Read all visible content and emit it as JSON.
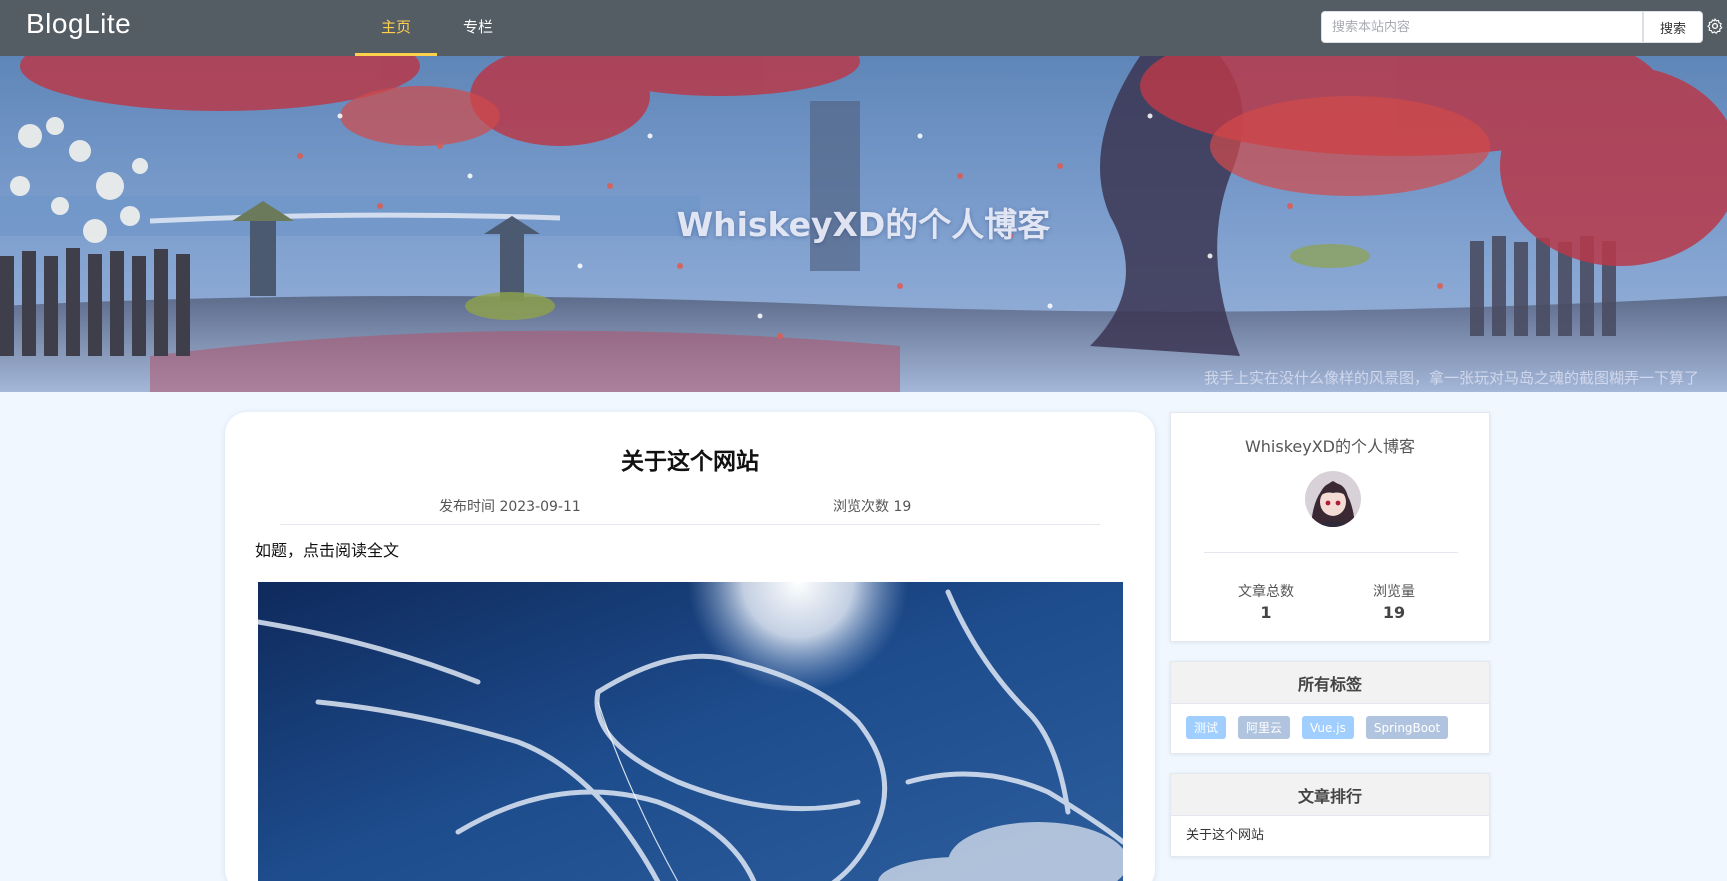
{
  "nav": {
    "logo": "BlogLite",
    "tabs": [
      {
        "label": "主页",
        "active": true
      },
      {
        "label": "专栏",
        "active": false
      }
    ],
    "search_placeholder": "搜索本站内容",
    "search_button": "搜索",
    "accent_color": "#ffd04b",
    "bar_color": "#545c64"
  },
  "banner": {
    "title": "WhiskeyXD的个人博客",
    "caption": "我手上实在没什么像样的风景图，拿一张玩对马岛之魂的截图糊弄一下算了"
  },
  "article": {
    "title": "关于这个网站",
    "date": "发布时间 2023-09-11",
    "views": "浏览次数 19",
    "summary": "如题，点击阅读全文"
  },
  "profile": {
    "name": "WhiskeyXD的个人博客",
    "stats": [
      {
        "label": "文章总数",
        "value": "1"
      },
      {
        "label": "浏览量",
        "value": "19"
      }
    ]
  },
  "tags_panel": {
    "title": "所有标签",
    "tags": [
      {
        "label": "测试",
        "color": "#a0cfff"
      },
      {
        "label": "阿里云",
        "color": "#b1c4df"
      },
      {
        "label": "Vue.js",
        "color": "#a0cfff"
      },
      {
        "label": "SpringBoot",
        "color": "#b1c4df"
      }
    ]
  },
  "ranking_panel": {
    "title": "文章排行",
    "items": [
      "关于这个网站"
    ]
  }
}
